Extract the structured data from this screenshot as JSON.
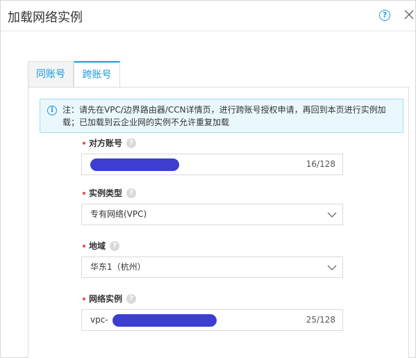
{
  "dialog": {
    "title": "加载网络实例",
    "help_symbol": "?"
  },
  "tabs": [
    {
      "label": "同账号",
      "active": false
    },
    {
      "label": "跨账号",
      "active": true
    }
  ],
  "notice": {
    "info_symbol": "i",
    "text": "注：请先在VPC/边界路由器/CCN详情页，进行跨账号授权申请，再回到本页进行实例加载；已加载到云企业网的实例不允许重复加载"
  },
  "form": {
    "help_symbol": "?",
    "peer_account": {
      "label": "对方账号",
      "value": "",
      "counter": "16/128"
    },
    "instance_type": {
      "label": "实例类型",
      "selected": "专有网络(VPC)"
    },
    "region": {
      "label": "地域",
      "selected": "华东1（杭州）"
    },
    "network_instance": {
      "label": "网络实例",
      "value": "vpc-",
      "counter": "25/128"
    }
  },
  "colors": {
    "accent": "#1a9ade",
    "required": "#e84a3c",
    "redaction": "#3c3ed0",
    "notice_bg": "#eaf8fd",
    "notice_border": "#9fdcf2"
  }
}
